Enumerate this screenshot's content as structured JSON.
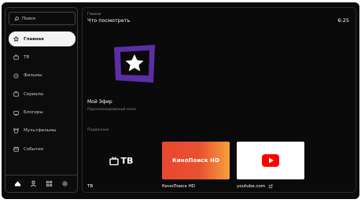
{
  "sidebar": {
    "search_label": "Поиск",
    "items": [
      {
        "label": "Главная",
        "icon": "home-icon",
        "active": true
      },
      {
        "label": "ТВ",
        "icon": "tv-icon",
        "active": false
      },
      {
        "label": "Фильмы",
        "icon": "film-icon",
        "active": false
      },
      {
        "label": "Сериалы",
        "icon": "series-icon",
        "active": false
      },
      {
        "label": "Блогеры",
        "icon": "bloggers-icon",
        "active": false
      },
      {
        "label": "Мультфильмы",
        "icon": "cartoons-icon",
        "active": false
      },
      {
        "label": "События",
        "icon": "events-icon",
        "active": false
      }
    ],
    "bottom_icons": [
      "home-icon",
      "user-icon",
      "grid-icon",
      "settings-icon"
    ]
  },
  "header": {
    "breadcrumb": "Главная",
    "title": "Что посмотреть",
    "time": "6:25"
  },
  "featured": {
    "name": "Мой Эфир",
    "description": "Персонализированный канал",
    "logo_color": "#5b2ea6"
  },
  "apps_section": {
    "label": "Подданные",
    "tiles": [
      {
        "caption": "ТВ",
        "logo_text": "ТВ"
      },
      {
        "caption": "КиноПоиск HD",
        "logo_text": "КиноПоиск HD"
      },
      {
        "caption": "youtube.com",
        "logo_text": ""
      }
    ]
  },
  "colors": {
    "background": "#0a0a0a",
    "active_nav": "#f4f4f4",
    "kinopoisk": "#e8472f",
    "youtube_red": "#ff0000"
  }
}
